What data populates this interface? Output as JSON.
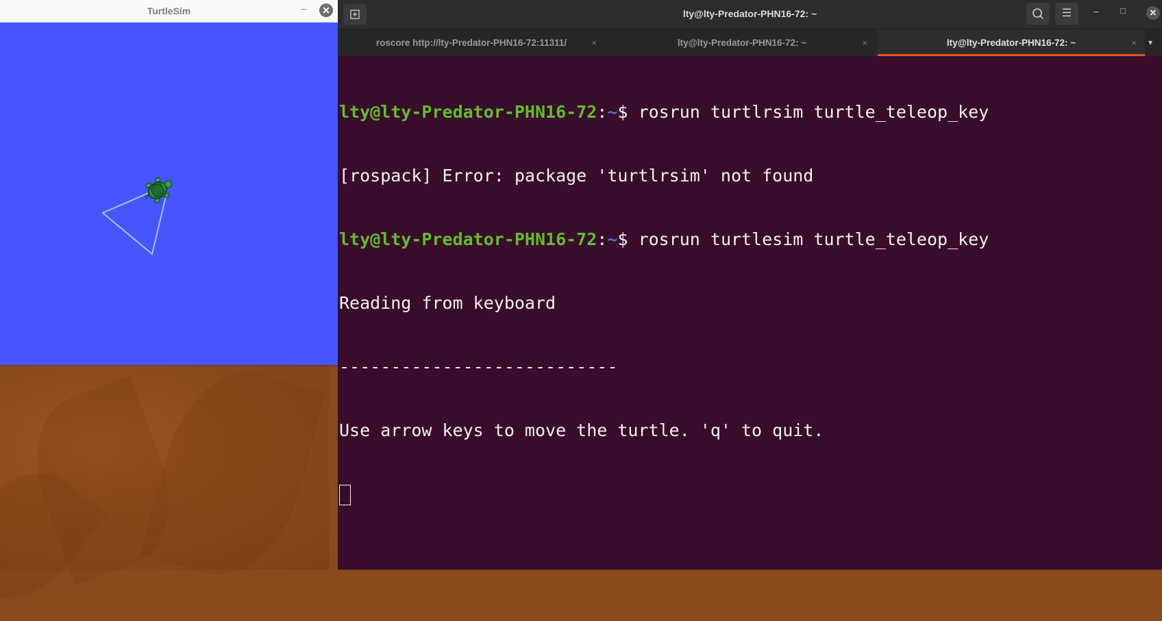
{
  "turtlesim": {
    "title": "TurtleSim",
    "minimize_glyph": "–",
    "close_glyph": "✕",
    "background_color": "#4556ff",
    "pen_color": "#b3c0ff"
  },
  "terminal": {
    "window_title": "lty@lty-Predator-PHN16-72: ~",
    "new_tab_icon": "new-tab-icon",
    "menu_glyph": "☰",
    "minimize_glyph": "–",
    "maximize_glyph": "□",
    "close_glyph": "✕",
    "tabs": [
      {
        "label": "roscore http://lty-Predator-PHN16-72:11311/",
        "close": "×",
        "active": false
      },
      {
        "label": "lty@lty-Predator-PHN16-72: ~",
        "close": "×",
        "active": false
      },
      {
        "label": "lty@lty-Predator-PHN16-72: ~",
        "close": "×",
        "active": true
      }
    ],
    "tab_dropdown_glyph": "▾",
    "lines": [
      {
        "type": "prompt",
        "user": "lty@lty-Predator-PHN16-72",
        "sep": ":",
        "path": "~",
        "dollar": "$ ",
        "command": "rosrun turtlrsim turtle_teleop_key"
      },
      {
        "type": "output",
        "text": "[rospack] Error: package 'turtlrsim' not found"
      },
      {
        "type": "prompt",
        "user": "lty@lty-Predator-PHN16-72",
        "sep": ":",
        "path": "~",
        "dollar": "$ ",
        "command": "rosrun turtlesim turtle_teleop_key"
      },
      {
        "type": "output",
        "text": "Reading from keyboard"
      },
      {
        "type": "output",
        "text": "---------------------------"
      },
      {
        "type": "output",
        "text": "Use arrow keys to move the turtle. 'q' to quit."
      }
    ],
    "accent_color": "#e95420",
    "background_color": "#380c2a"
  }
}
